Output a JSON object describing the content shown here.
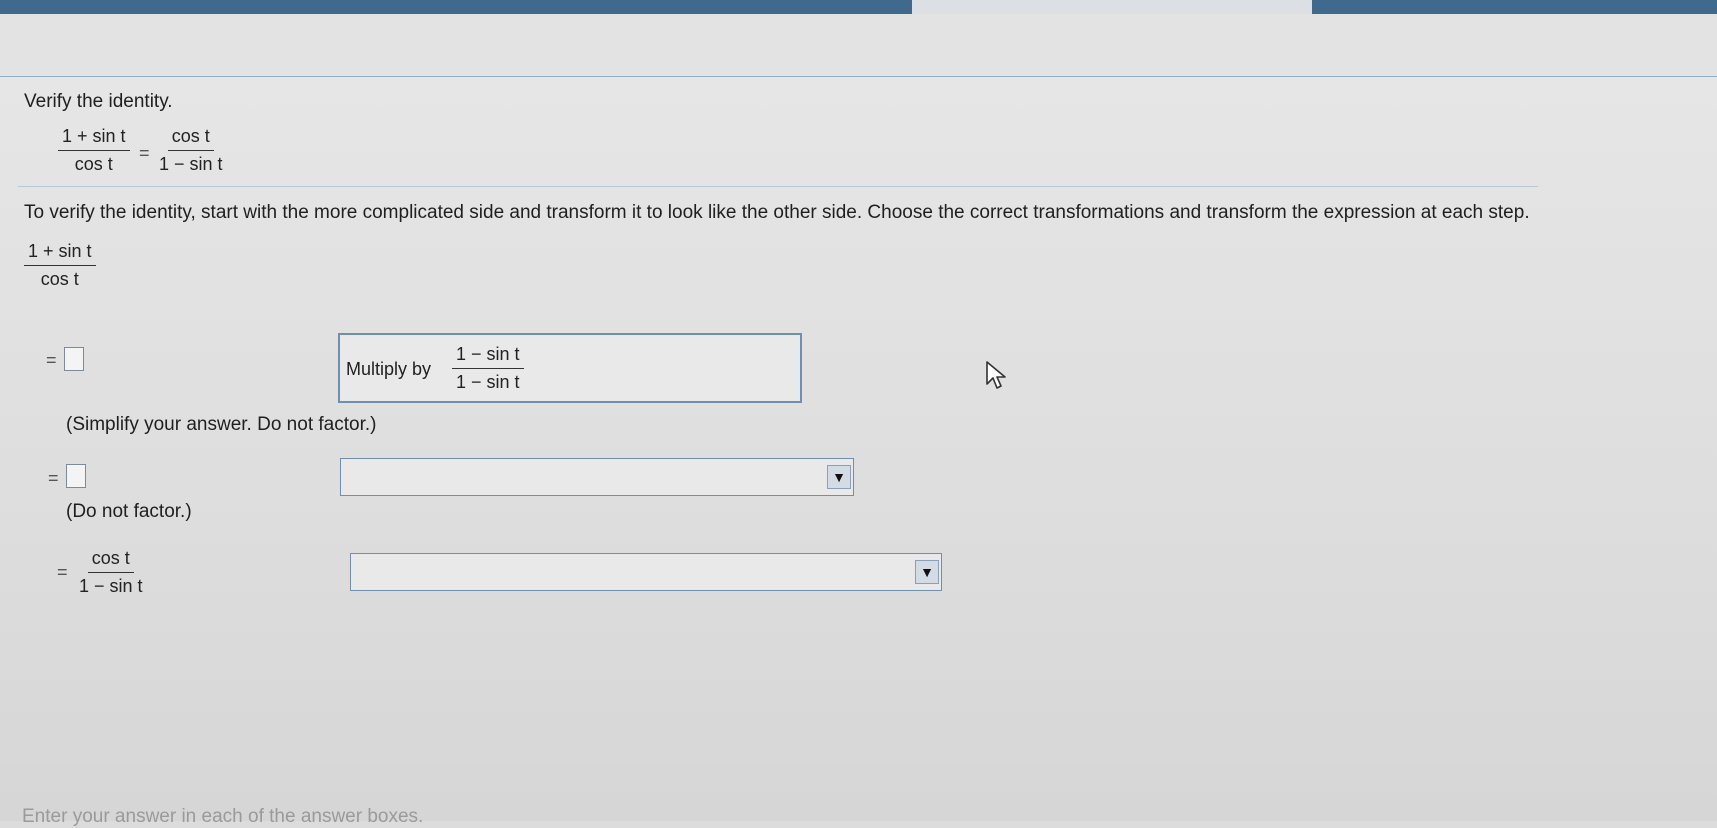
{
  "question": {
    "prompt": "Verify the identity.",
    "identity": {
      "left_num": "1 + sin t",
      "left_den": "cos t",
      "equals": "=",
      "right_num": "cos t",
      "right_den": "1 − sin t"
    }
  },
  "instructions": "To verify the identity, start with the more complicated side and transform it to look like the other side. Choose the correct transformations and transform the expression at each step.",
  "steps": {
    "start": {
      "num": "1 + sin t",
      "den": "cos t"
    },
    "step1": {
      "equals": "=",
      "hint": "(Simplify your answer. Do not factor.)",
      "dropdown_prefix": "Multiply by",
      "dropdown_num": "1 − sin t",
      "dropdown_den": "1 − sin t"
    },
    "step2": {
      "equals": "=",
      "hint": "(Do not factor.)",
      "dropdown_value": ""
    },
    "step3": {
      "equals": "=",
      "num": "cos t",
      "den": "1 − sin t",
      "dropdown_value": ""
    }
  },
  "footer_text": "Enter your answer in each of the answer boxes.",
  "icons": {
    "dropdown_arrow": "▼",
    "cursor": "mouse-pointer-icon"
  },
  "colors": {
    "topbar": "#3f6a8e",
    "select_border": "#6f8fb0"
  }
}
